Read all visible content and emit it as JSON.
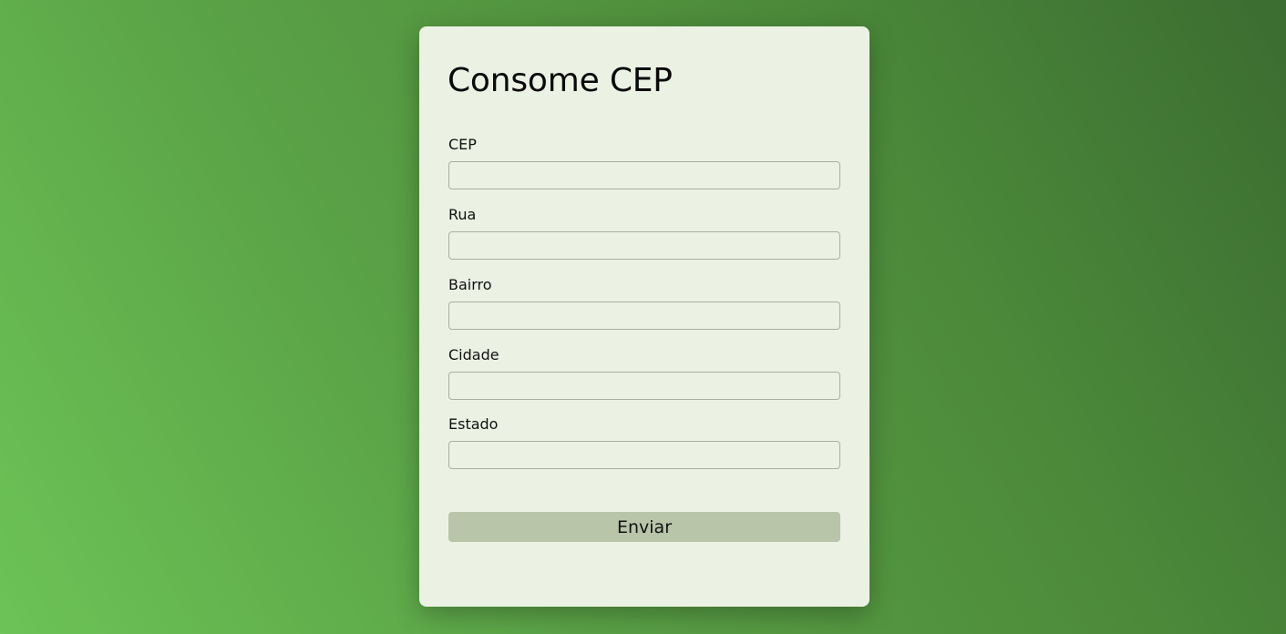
{
  "form": {
    "title": "Consome CEP",
    "fields": [
      {
        "label": "CEP",
        "value": "",
        "placeholder": ""
      },
      {
        "label": "Rua",
        "value": "",
        "placeholder": ""
      },
      {
        "label": "Bairro",
        "value": "",
        "placeholder": ""
      },
      {
        "label": "Cidade",
        "value": "",
        "placeholder": ""
      },
      {
        "label": "Estado",
        "value": "",
        "placeholder": ""
      }
    ],
    "submit_label": "Enviar"
  },
  "colors": {
    "card_background": "#ebf1e3",
    "button_background": "#b8c5a9",
    "input_border": "#a9b0a2",
    "background_gradient_start": "#6cc356",
    "background_gradient_end": "#3b6c31"
  }
}
